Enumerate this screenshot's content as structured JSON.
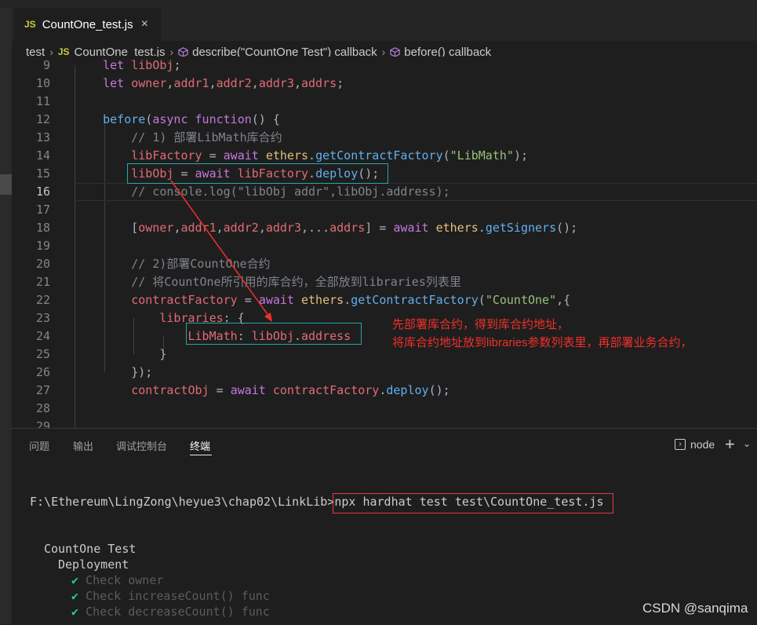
{
  "tab": {
    "icon": "JS",
    "filename": "CountOne_test.js",
    "close": "×"
  },
  "breadcrumb": {
    "folder": "test",
    "file_icon": "JS",
    "file": "CountOne_test.js",
    "symbol1": "describe(\"CountOne Test\") callback",
    "symbol2": "before() callback",
    "separator": "›"
  },
  "editor": {
    "lines": [
      {
        "n": "9",
        "t": "    let libObj;"
      },
      {
        "n": "10",
        "t": "    let owner,addr1,addr2,addr3,addrs;"
      },
      {
        "n": "11",
        "t": ""
      },
      {
        "n": "12",
        "t": "    before(async function() {"
      },
      {
        "n": "13",
        "t": "        // 1) 部署LibMath库合约"
      },
      {
        "n": "14",
        "t": "        libFactory = await ethers.getContractFactory(\"LibMath\");"
      },
      {
        "n": "15",
        "t": "        libObj = await libFactory.deploy();"
      },
      {
        "n": "16",
        "t": "        // console.log(\"libObj addr\",libObj.address);"
      },
      {
        "n": "17",
        "t": ""
      },
      {
        "n": "18",
        "t": "        [owner,addr1,addr2,addr3,...addrs] = await ethers.getSigners();"
      },
      {
        "n": "19",
        "t": ""
      },
      {
        "n": "20",
        "t": "        // 2)部署CountOne合约"
      },
      {
        "n": "21",
        "t": "        // 将CountOne所引用的库合约，全部放到libraries列表里"
      },
      {
        "n": "22",
        "t": "        contractFactory = await ethers.getContractFactory(\"CountOne\",{"
      },
      {
        "n": "23",
        "t": "            libraries: {"
      },
      {
        "n": "24",
        "t": "                LibMath: libObj.address"
      },
      {
        "n": "25",
        "t": "            }"
      },
      {
        "n": "26",
        "t": "        });"
      },
      {
        "n": "27",
        "t": "        contractObj = await contractFactory.deploy();"
      },
      {
        "n": "28",
        "t": ""
      },
      {
        "n": "29",
        "t": ""
      }
    ],
    "current_line": "16"
  },
  "annotation": {
    "line1": "先部署库合约，得到库合约地址，",
    "line2": "将库合约地址放到libraries参数列表里，再部署业务合约，"
  },
  "panel": {
    "tabs": [
      "问题",
      "输出",
      "调试控制台",
      "终端"
    ],
    "active_tab": "终端",
    "shell": "node",
    "add": "+",
    "dropdown": "⌄"
  },
  "terminal": {
    "prompt": "F:\\Ethereum\\LingZong\\heyue3\\chap02\\LinkLib>",
    "command": "npx hardhat test test\\CountOne_test.js",
    "suite": "CountOne Test",
    "group": "Deployment",
    "check_mark": "✔",
    "tests": [
      "Check owner",
      "Check increaseCount() func",
      "Check decreaseCount() func"
    ]
  },
  "watermark": "CSDN @sanqima",
  "colors": {
    "annotation_red": "#f0302a",
    "highlight_box": "#25a8a8",
    "command_box": "#e03c3c",
    "pass_green": "#23d18b"
  }
}
